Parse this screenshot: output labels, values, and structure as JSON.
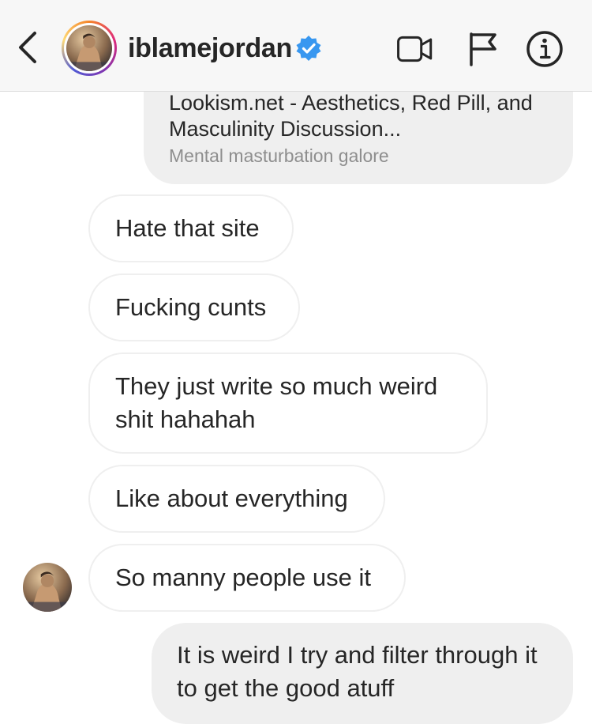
{
  "header": {
    "username": "iblamejordan",
    "verified_icon": "verified-badge-icon",
    "back_icon": "chevron-left-icon",
    "actions": [
      "video-call-icon",
      "flag-icon",
      "info-icon"
    ],
    "ring_colors": [
      "#f58529",
      "#dd2a7b",
      "#8134af"
    ],
    "verified_color": "#3897f0"
  },
  "link_preview": {
    "title": "Lookism.net - Aesthetics, Red Pill, and Masculinity Discussion...",
    "subtitle": "Mental masturbation galore"
  },
  "messages": [
    {
      "sender": "them",
      "text": "Hate that site"
    },
    {
      "sender": "them",
      "text": "Fucking cunts"
    },
    {
      "sender": "them",
      "text": "They just write so much weird shit hahahah"
    },
    {
      "sender": "them",
      "text": "Like about everything"
    },
    {
      "sender": "them",
      "text": "So manny people use it"
    },
    {
      "sender": "me",
      "text": "It is weird I try and filter through it to get the good atuff"
    }
  ]
}
